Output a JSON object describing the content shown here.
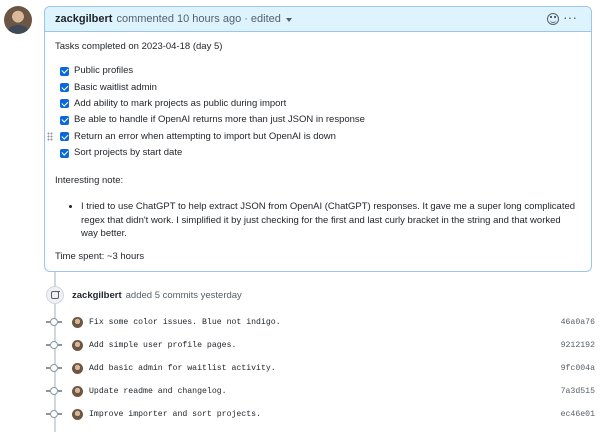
{
  "comment": {
    "author": "zackgilbert",
    "meta_text": "commented 10 hours ago",
    "separator": "·",
    "edited_label": "edited",
    "intro": "Tasks completed on 2023-04-18 (day 5)",
    "tasks": [
      {
        "label": "Public profiles",
        "checked": true
      },
      {
        "label": "Basic waitlist admin",
        "checked": true
      },
      {
        "label": "Add ability to mark projects as public during import",
        "checked": true
      },
      {
        "label": "Be able to handle if OpenAI returns more than just JSON in response",
        "checked": true
      },
      {
        "label": "Return an error when attempting to import but OpenAI is down",
        "checked": true
      },
      {
        "label": "Sort projects by start date",
        "checked": true
      }
    ],
    "note_title": "Interesting note:",
    "note_bullets": [
      "I tried to use ChatGPT to help extract JSON from OpenAI (ChatGPT) responses. It gave me a super long complicated regex that didn't work. I simplified it by just checking for the first and last curly bracket in the string and that worked way better."
    ],
    "time_spent": "Time spent: ~3 hours",
    "icons": {
      "reaction": "smiley-icon",
      "menu": "kebab-icon",
      "edited": "chevron-down-icon",
      "drag": "drag-handle-icon"
    },
    "colors": {
      "header_bg": "#ddf4ff",
      "border": "#9cc4ee",
      "checkbox": "#0969da"
    }
  },
  "commit_event": {
    "author": "zackgilbert",
    "text": "added 5 commits yesterday",
    "icon": "commit-icon"
  },
  "commits": [
    {
      "message": "Fix some color issues. Blue not indigo.",
      "sha": "46a0a76"
    },
    {
      "message": "Add simple user profile pages.",
      "sha": "9212192"
    },
    {
      "message": "Add basic admin for waitlist activity.",
      "sha": "9fc004a"
    },
    {
      "message": "Update readme and changelog.",
      "sha": "7a3d515"
    },
    {
      "message": "Improve importer and sort projects.",
      "sha": "ec46e01"
    }
  ]
}
